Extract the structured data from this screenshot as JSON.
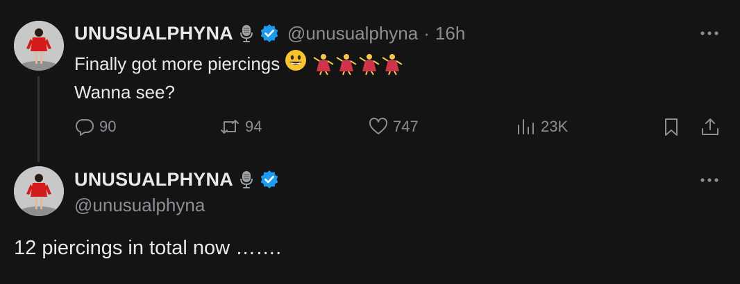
{
  "tweet": {
    "display_name": "UNUSUALPHYNA",
    "handle": "@unusualphyna",
    "separator": "·",
    "time": "16h",
    "text_line1": "Finally got more piercings",
    "text_line2": "Wanna see?",
    "stats": {
      "replies": "90",
      "retweets": "94",
      "likes": "747",
      "views": "23K"
    }
  },
  "reply": {
    "display_name": "UNUSUALPHYNA",
    "handle": "@unusualphyna",
    "text": "12 piercings in total now ……."
  },
  "icons": {
    "more": "more-icon",
    "verified": "verified-badge-icon",
    "mic": "microphone-badge-icon",
    "reply": "reply-icon",
    "retweet": "retweet-icon",
    "like": "heart-icon",
    "views": "views-icon",
    "bookmark": "bookmark-icon",
    "share": "share-icon"
  },
  "colors": {
    "background": "#141414",
    "verified": "#1d9bf0",
    "muted": "#8b8f94",
    "text": "#e7e9ea"
  }
}
